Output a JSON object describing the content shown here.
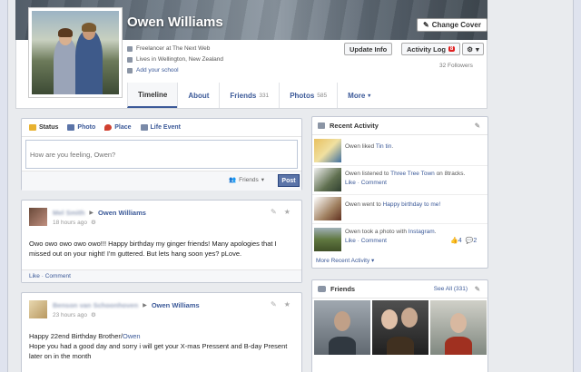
{
  "profile": {
    "name": "Owen Williams",
    "change_cover_label": "Change Cover",
    "info": [
      {
        "icon": "briefcase-icon",
        "text": "Freelancer at The Next Web"
      },
      {
        "icon": "home-icon",
        "text": "Lives in Wellington, New Zealand"
      },
      {
        "icon": "school-icon",
        "text": "Add your school"
      }
    ],
    "update_info_label": "Update Info",
    "activity_log_label": "Activity Log",
    "activity_log_badge": "8",
    "settings_label": "▾",
    "followers": "32 Followers"
  },
  "tabs": [
    {
      "label": "Timeline",
      "count": ""
    },
    {
      "label": "About",
      "count": ""
    },
    {
      "label": "Friends",
      "count": "331"
    },
    {
      "label": "Photos",
      "count": "585"
    },
    {
      "label": "More",
      "count": "▾"
    }
  ],
  "composer": {
    "tabs": [
      "Status",
      "Photo",
      "Place",
      "Life Event"
    ],
    "placeholder": "How are you feeling, Owen?",
    "audience": "Friends",
    "post_label": "Post"
  },
  "stories": [
    {
      "author_blurred": "Mel Smith",
      "target": "Owen Williams",
      "time": "18 hours ago",
      "text": "Owo owo owo owo owo!!! Happy birthday my ginger friends! Many apologies that I missed out on your night! I'm guttered. But lets hang soon yes? pLove.",
      "footer": "Like · Comment"
    },
    {
      "author_blurred": "Benson van Schoonhoven",
      "target": "Owen Williams",
      "time": "23 hours ago",
      "line1_prefix": "Happy 22end Birthday Brother/",
      "line1_link": "Owen",
      "text2": "Hope you had a good day and sorry i will get your X-mas Pressent and B-day Present later on in the month"
    }
  ],
  "recent_activity": {
    "title": "Recent Activity",
    "items": [
      {
        "prefix": "Owen liked ",
        "link": "Tin tin",
        "suffix": ".",
        "links": "",
        "likes": "",
        "comments": ""
      },
      {
        "prefix": "Owen listened to ",
        "link": "Three Tree Town",
        "suffix": " on 8tracks.",
        "links": "Like · Comment",
        "likes": "",
        "comments": ""
      },
      {
        "prefix": "Owen went to ",
        "link": "Happy birthday to me!",
        "suffix": "",
        "links": "",
        "likes": "",
        "comments": ""
      },
      {
        "prefix": "Owen took a photo with ",
        "link": "Instagram",
        "suffix": ".",
        "links": "Like · Comment",
        "likes": "4",
        "comments": "2"
      }
    ],
    "more_label": "More Recent Activity ▾"
  },
  "friends": {
    "title": "Friends",
    "see_all": "See All (331)"
  }
}
